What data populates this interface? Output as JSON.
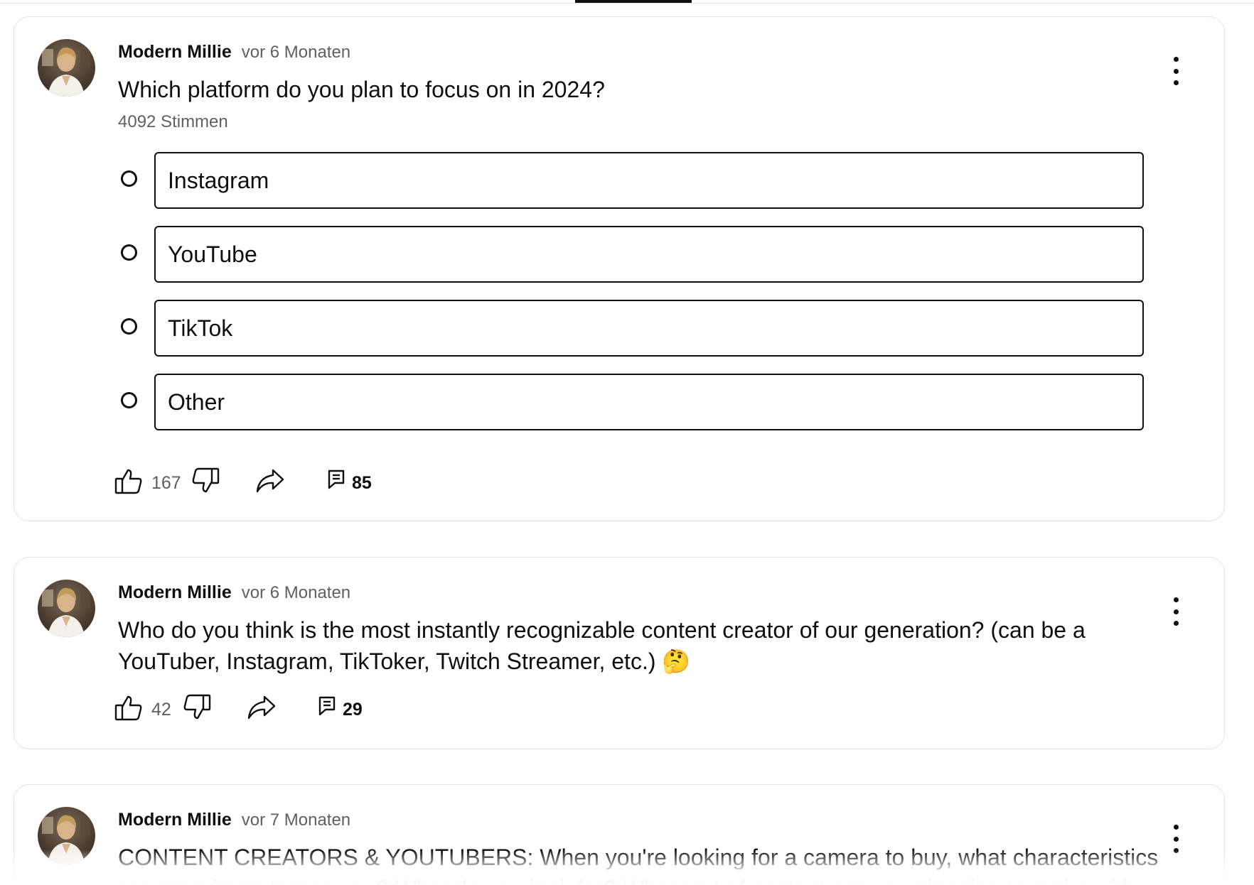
{
  "posts": [
    {
      "author": "Modern Millie",
      "time": "vor 6 Monaten",
      "text": "Which platform do you plan to focus on in 2024?",
      "votes": "4092 Stimmen",
      "options": [
        "Instagram",
        "YouTube",
        "TikTok",
        "Other"
      ],
      "likes": "167",
      "comments": "85"
    },
    {
      "author": "Modern Millie",
      "time": "vor 6 Monaten",
      "text": "Who do you think is the most instantly recognizable content creator of our generation? (can be a YouTuber, Instagram, TikToker, Twitch Streamer, etc.) 🤔",
      "likes": "42",
      "comments": "29"
    },
    {
      "author": "Modern Millie",
      "time": "vor 7 Monaten",
      "text": "CONTENT CREATORS & YOUTUBERS: When you're looking for a camera to buy, what characteristics are most important to you? What do you look for? What sort of content are you planning to make with"
    }
  ]
}
